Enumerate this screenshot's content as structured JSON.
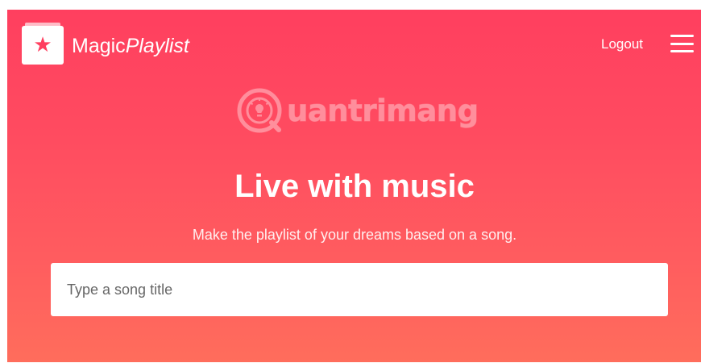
{
  "header": {
    "logo_icon": "star-icon",
    "brand_regular": "Magic",
    "brand_italic": "Playlist",
    "logout_label": "Logout",
    "menu_icon": "hamburger-menu-icon"
  },
  "watermark": {
    "icon": "lightbulb-icon",
    "text": "uantrimang"
  },
  "hero": {
    "title": "Live with music",
    "subtitle": "Make the playlist of your dreams based on a song."
  },
  "search": {
    "placeholder": "Type a song title",
    "value": ""
  },
  "colors": {
    "gradient_top": "#ff3f5f",
    "gradient_bottom": "#ff6d5c",
    "accent": "#ff3f5f",
    "text": "#ffffff"
  }
}
